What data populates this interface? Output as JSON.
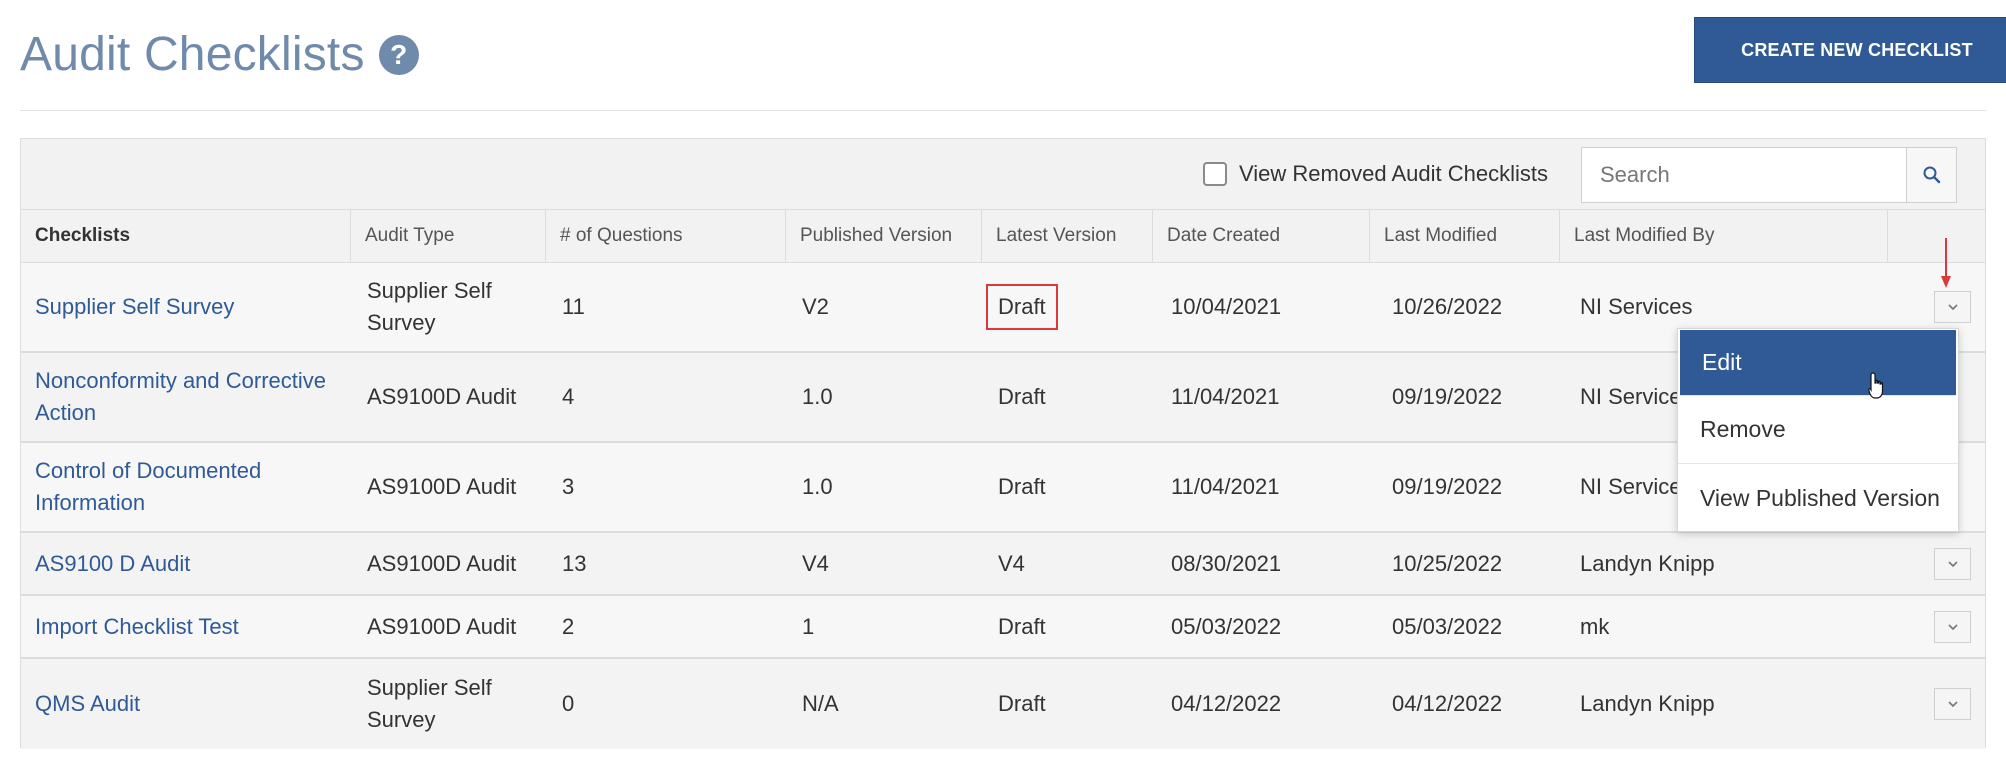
{
  "header": {
    "title": "Audit Checklists",
    "help_icon": "?",
    "create_label": "CREATE NEW CHECKLIST"
  },
  "toolbar": {
    "view_removed_label": "View Removed Audit Checklists",
    "view_removed_checked": false,
    "search_placeholder": "Search"
  },
  "table": {
    "columns": [
      "Checklists",
      "Audit Type",
      "# of Questions",
      "Published Version",
      "Latest Version",
      "Date Created",
      "Last Modified",
      "Last Modified By"
    ],
    "rows": [
      {
        "name": "Supplier Self Survey",
        "type": "Supplier Self Survey",
        "questions": "11",
        "published": "V2",
        "latest": "Draft",
        "created": "10/04/2021",
        "modified": "10/26/2022",
        "by": "NI Services"
      },
      {
        "name": "Nonconformity and Corrective Action",
        "type": "AS9100D Audit",
        "questions": "4",
        "published": "1.0",
        "latest": "Draft",
        "created": "11/04/2021",
        "modified": "09/19/2022",
        "by": "NI Services"
      },
      {
        "name": "Control of Documented Information",
        "type": "AS9100D Audit",
        "questions": "3",
        "published": "1.0",
        "latest": "Draft",
        "created": "11/04/2021",
        "modified": "09/19/2022",
        "by": "NI Services"
      },
      {
        "name": "AS9100 D Audit",
        "type": "AS9100D Audit",
        "questions": "13",
        "published": "V4",
        "latest": "V4",
        "created": "08/30/2021",
        "modified": "10/25/2022",
        "by": "Landyn Knipp"
      },
      {
        "name": "Import Checklist Test",
        "type": "AS9100D Audit",
        "questions": "2",
        "published": "1",
        "latest": "Draft",
        "created": "05/03/2022",
        "modified": "05/03/2022",
        "by": "mk"
      },
      {
        "name": "QMS Audit",
        "type": "Supplier Self Survey",
        "questions": "0",
        "published": "N/A",
        "latest": "Draft",
        "created": "04/12/2022",
        "modified": "04/12/2022",
        "by": "Landyn Knipp"
      }
    ]
  },
  "menu": {
    "items": [
      "Edit",
      "Remove",
      "View Published Version"
    ],
    "active_index": 0
  },
  "colors": {
    "primary": "#2f5a96",
    "title": "#6f8aab",
    "highlight": "#d83a3a"
  }
}
